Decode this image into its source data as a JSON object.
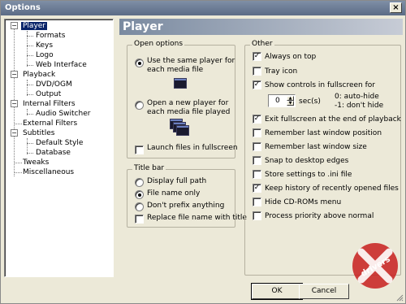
{
  "window": {
    "title": "Options",
    "close_glyph": "×"
  },
  "tree": {
    "nodes": [
      {
        "label": "Player",
        "selected": true
      },
      {
        "label": "Formats"
      },
      {
        "label": "Keys"
      },
      {
        "label": "Logo"
      },
      {
        "label": "Web Interface"
      },
      {
        "label": "Playback"
      },
      {
        "label": "DVD/OGM"
      },
      {
        "label": "Output"
      },
      {
        "label": "Internal Filters"
      },
      {
        "label": "Audio Switcher"
      },
      {
        "label": "External Filters"
      },
      {
        "label": "Subtitles"
      },
      {
        "label": "Default Style"
      },
      {
        "label": "Database"
      },
      {
        "label": "Tweaks"
      },
      {
        "label": "Miscellaneous"
      }
    ]
  },
  "header": {
    "title": "Player"
  },
  "open_options": {
    "title": "Open options",
    "same_player": {
      "label_line1": "Use the same player for",
      "label_line2": "each media file",
      "checked": true
    },
    "new_player": {
      "label_line1": "Open a new player for",
      "label_line2": "each media file played",
      "checked": false
    },
    "launch_fullscreen": {
      "label": "Launch files in fullscreen",
      "checked": false
    }
  },
  "title_bar": {
    "title": "Title bar",
    "options": [
      {
        "label": "Display full path",
        "checked": false
      },
      {
        "label": "File name only",
        "checked": true
      },
      {
        "label": "Don't prefix anything",
        "checked": false
      }
    ],
    "replace_title": {
      "label": "Replace file name with title",
      "checked": false
    }
  },
  "other": {
    "title": "Other",
    "items": [
      {
        "label": "Always on top",
        "checked": true
      },
      {
        "label": "Tray icon",
        "checked": false
      },
      {
        "label": "Show controls in fullscreen for",
        "checked": true
      },
      {
        "label": "Exit fullscreen at the end of playback",
        "checked": true
      },
      {
        "label": "Remember last window position",
        "checked": false
      },
      {
        "label": "Remember last window size",
        "checked": false
      },
      {
        "label": "Snap to desktop edges",
        "checked": false
      },
      {
        "label": "Store settings to .ini file",
        "checked": false
      },
      {
        "label": "Keep history of recently opened files",
        "checked": true
      },
      {
        "label": "Hide CD-ROMs menu",
        "checked": false
      },
      {
        "label": "Process priority above normal",
        "checked": false
      }
    ],
    "seconds": {
      "value": "0",
      "unit": "sec(s)",
      "hint1": "0: auto-hide",
      "hint2": "-1: don't hide"
    }
  },
  "buttons": {
    "ok": "OK",
    "cancel": "Cancel"
  },
  "watermark": {
    "text": "drivers"
  }
}
